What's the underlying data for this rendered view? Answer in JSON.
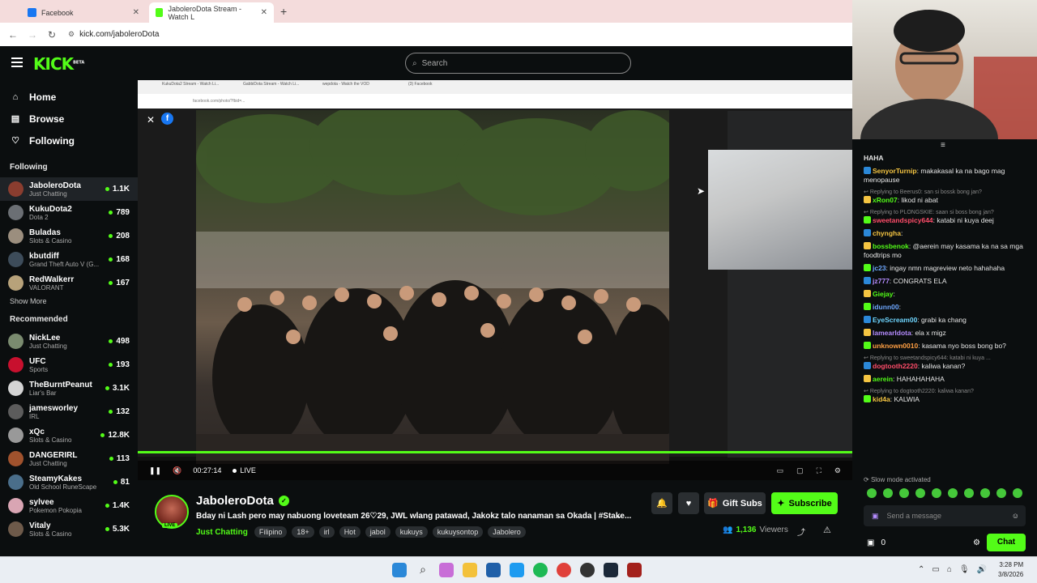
{
  "browser": {
    "tabs": [
      {
        "title": "Facebook",
        "color": "#1877f2"
      },
      {
        "title": "JaboleroDota Stream - Watch L",
        "color": "#53fc18"
      }
    ],
    "url": "kick.com/jaboleroDota",
    "new_tab": "+"
  },
  "header": {
    "logo": "KICK",
    "logo_sup": "BETA",
    "search_placeholder": "Search"
  },
  "sidebar": {
    "nav": [
      {
        "label": "Home",
        "icon": "home-icon"
      },
      {
        "label": "Browse",
        "icon": "browse-icon"
      },
      {
        "label": "Following",
        "icon": "heart-icon"
      }
    ],
    "following_title": "Following",
    "following": [
      {
        "name": "JaboleroDota",
        "category": "Just Chatting",
        "viewers": "1.1K",
        "avatar": "#8a3d2f"
      },
      {
        "name": "KukuDota2",
        "category": "Dota 2",
        "viewers": "789",
        "avatar": "#6b6f74"
      },
      {
        "name": "Buladas",
        "category": "Slots & Casino",
        "viewers": "208",
        "avatar": "#9b8e7e"
      },
      {
        "name": "kbutdiff",
        "category": "Grand Theft Auto V (G...",
        "viewers": "168",
        "avatar": "#3d4c5a"
      },
      {
        "name": "RedWalkerr",
        "category": "VALORANT",
        "viewers": "167",
        "avatar": "#b7a27a"
      }
    ],
    "show_more": "Show More",
    "recommended_title": "Recommended",
    "recommended": [
      {
        "name": "NickLee",
        "category": "Just Chatting",
        "viewers": "498",
        "avatar": "#7a8b6f"
      },
      {
        "name": "UFC",
        "category": "Sports",
        "viewers": "193",
        "avatar": "#c8102e"
      },
      {
        "name": "TheBurntPeanut",
        "category": "Liar's Bar",
        "viewers": "3.1K",
        "avatar": "#d4d4d4"
      },
      {
        "name": "jamesworley",
        "category": "IRL",
        "viewers": "132",
        "avatar": "#5c5c5c"
      },
      {
        "name": "xQc",
        "category": "Slots & Casino",
        "viewers": "12.8K",
        "avatar": "#999999"
      },
      {
        "name": "DANGERIRL",
        "category": "Just Chatting",
        "viewers": "113",
        "avatar": "#a0522d"
      },
      {
        "name": "SteamyKakes",
        "category": "Old School RuneScape",
        "viewers": "81",
        "avatar": "#4a6e8a"
      },
      {
        "name": "sylvee",
        "category": "Pokemon Pokopia",
        "viewers": "1.4K",
        "avatar": "#d9a5b3"
      },
      {
        "name": "Vitaly",
        "category": "Slots & Casino",
        "viewers": "5.3K",
        "avatar": "#6e5a4a"
      }
    ]
  },
  "player": {
    "time": "00:27:14",
    "live": "LIVE"
  },
  "stream": {
    "name": "JaboleroDota",
    "live_badge": "LIVE",
    "title": "Bday ni Lash pero may nabuong loveteam 26♡29, JWL wlang patawad, Jakokz talo nanaman sa Okada | #Stake...",
    "category": "Just Chatting",
    "tags": [
      "Filipino",
      "18+",
      "irl",
      "Hot",
      "jabol",
      "kukuys",
      "kukuysontop",
      "Jabolero"
    ],
    "viewers": "1,136",
    "viewers_label": "Viewers",
    "gift_subs": "Gift Subs",
    "subscribe": "Subscribe",
    "accent": "#53fc18"
  },
  "chat": {
    "pinned": "HAHA",
    "messages": [
      {
        "reply": "",
        "user": "SenyorTurnip",
        "color": "#f5c542",
        "text": "makakasal ka na bago mag menopause"
      },
      {
        "reply": "Replying to Beerus0: san si bossk bong jan?",
        "user": "xRon07",
        "color": "#53fc18",
        "text": "likod ni abat"
      },
      {
        "reply": "Replying to PLONGSKIE: saan si boss bong jan?",
        "user": "sweetandspicy644",
        "color": "#ff4d6a",
        "text": "katabi ni kuya deej"
      },
      {
        "reply": "",
        "user": "chyngha",
        "color": "#f5c542",
        "text": ""
      },
      {
        "reply": "",
        "user": "bossbenok",
        "color": "#53fc18",
        "text": "@aerein may kasama ka na sa mga foodtrips mo"
      },
      {
        "reply": "",
        "user": "jc23",
        "color": "#6fa8ff",
        "text": "ingay nmn magreview neto hahahaha"
      },
      {
        "reply": "",
        "user": "jz777",
        "color": "#b58cff",
        "text": "CONGRATS ELA"
      },
      {
        "reply": "",
        "user": "Giejay",
        "color": "#53fc18",
        "text": ""
      },
      {
        "reply": "",
        "user": "idunn00",
        "color": "#6fa8ff",
        "text": ""
      },
      {
        "reply": "",
        "user": "EyeScream00",
        "color": "#6fd6ff",
        "text": "grabi ka chang"
      },
      {
        "reply": "",
        "user": "lamearldota",
        "color": "#b58cff",
        "text": "ela x migz"
      },
      {
        "reply": "",
        "user": "unknown0010",
        "color": "#ff9f43",
        "text": "kasama nyo boss bong bo?"
      },
      {
        "reply": "Replying to sweetandspicy644: katabi ni kuya ...",
        "user": "dogtooth2220",
        "color": "#ff4d6a",
        "text": "kaliwa kanan?"
      },
      {
        "reply": "",
        "user": "aerein",
        "color": "#53fc18",
        "text": "HAHAHAHAHA"
      },
      {
        "reply": "Replying to dogtooth2220: kaliwa kanan?",
        "user": "kid4a",
        "color": "#f5c542",
        "text": "KALWIA"
      }
    ],
    "slow_mode": "Slow mode activated",
    "input_placeholder": "Send a message",
    "points": "0",
    "send_label": "Chat"
  },
  "taskbar": {
    "time": "3:28 PM",
    "date": "3/8/2026"
  }
}
